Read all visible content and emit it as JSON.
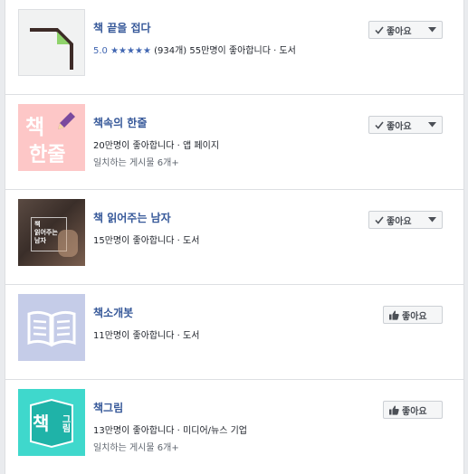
{
  "pages": [
    {
      "name": "책 끝을 접다",
      "rating_value": "5.0",
      "stars": "★★★★★",
      "rating_count": "(934개)",
      "line1_rest": "55만명이 좋아합니다 · 도서",
      "button_label": "좋아요",
      "liked": true
    },
    {
      "name": "책속의 한줄",
      "line1": "20만명이 좋아합니다 · 앱 페이지",
      "line2": "일치하는 게시물 6개+",
      "thumb_text_1": "책",
      "thumb_text_2": "한줄",
      "button_label": "좋아요",
      "liked": true
    },
    {
      "name": "책 읽어주는 남자",
      "line1": "15만명이 좋아합니다 · 도서",
      "thumb_text": [
        "책",
        "읽어주는",
        "남자"
      ],
      "button_label": "좋아요",
      "liked": true
    },
    {
      "name": "책소개봇",
      "line1": "11만명이 좋아합니다 · 도서",
      "button_label": "좋아요",
      "liked": false
    },
    {
      "name": "책그림",
      "line1": "13만명이 좋아합니다 · 미디어/뉴스 기업",
      "line2": "일치하는 게시물 6개+",
      "thumb_text_1": "책",
      "thumb_text_2": "그림",
      "button_label": "좋아요",
      "liked": false
    }
  ],
  "colors": {
    "link": "#365899",
    "star": "#4267b2",
    "thumb2_bg": "#fdc7c7",
    "thumb4_bg": "#c5cce8",
    "thumb5_bg": "#3fd8cc"
  }
}
